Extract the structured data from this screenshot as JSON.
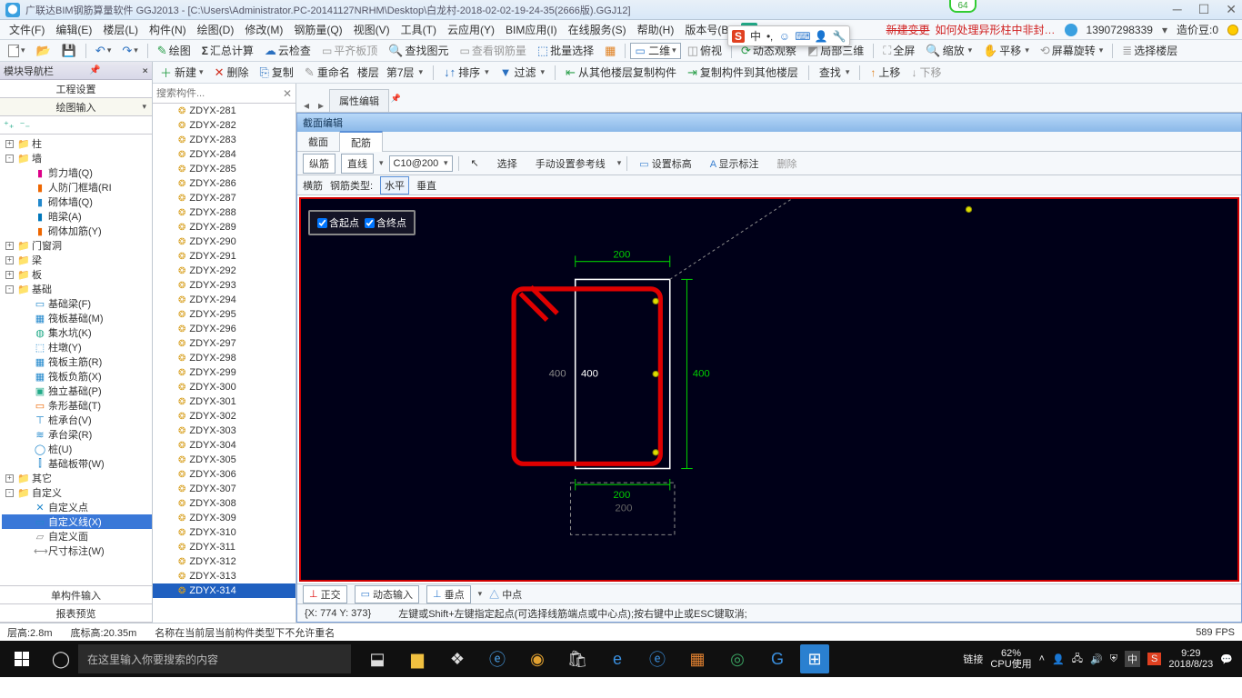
{
  "title": "广联达BIM钢筋算量软件 GGJ2013 - [C:\\Users\\Administrator.PC-20141127NRHM\\Desktop\\白龙村-2018-02-02-19-24-35(2666版).GGJ12]",
  "pill64": "64",
  "menubar": {
    "items": [
      "文件(F)",
      "编辑(E)",
      "楼层(L)",
      "构件(N)",
      "绘图(D)",
      "修改(M)",
      "钢筋量(Q)",
      "视图(V)",
      "工具(T)",
      "云应用(Y)",
      "BIM应用(I)",
      "在线服务(S)",
      "帮助(H)",
      "版本号(B)"
    ],
    "newlink": "新建变更",
    "redlink": "如何处理异形柱中非封…",
    "user": "13907298339",
    "coin_label": "造价豆:0"
  },
  "toolbar1": {
    "items": [
      "绘图",
      "汇总计算",
      "云检查",
      "平齐板顶",
      "查找图元",
      "查看钢筋量",
      "批量选择"
    ],
    "dim_combo": "二维",
    "view_items": [
      "俯视",
      "动态观察",
      "局部三维",
      "全屏",
      "缩放",
      "平移",
      "屏幕旋转",
      "选择楼层"
    ]
  },
  "nav_header": "模块导航栏",
  "nav_sub1": "工程设置",
  "nav_sub2": "绘图输入",
  "tree": [
    {
      "exp": "+",
      "ind": 0,
      "icon": "📁",
      "label": "柱"
    },
    {
      "exp": "-",
      "ind": 0,
      "icon": "📁",
      "label": "墙"
    },
    {
      "ind": 1,
      "icon": "▮",
      "label": "剪力墙(Q)",
      "c": "#d08"
    },
    {
      "ind": 1,
      "icon": "▮",
      "label": "人防门框墙(RI",
      "c": "#e60"
    },
    {
      "ind": 1,
      "icon": "▮",
      "label": "砌体墙(Q)",
      "c": "#28c"
    },
    {
      "ind": 1,
      "icon": "▮",
      "label": "暗梁(A)",
      "c": "#07b"
    },
    {
      "ind": 1,
      "icon": "▮",
      "label": "砌体加筋(Y)",
      "c": "#e60"
    },
    {
      "exp": "+",
      "ind": 0,
      "icon": "📁",
      "label": "门窗洞"
    },
    {
      "exp": "+",
      "ind": 0,
      "icon": "📁",
      "label": "梁"
    },
    {
      "exp": "+",
      "ind": 0,
      "icon": "📁",
      "label": "板"
    },
    {
      "exp": "-",
      "ind": 0,
      "icon": "📁",
      "label": "基础"
    },
    {
      "ind": 1,
      "icon": "▭",
      "label": "基础梁(F)",
      "c": "#28c"
    },
    {
      "ind": 1,
      "icon": "▦",
      "label": "筏板基础(M)",
      "c": "#28c"
    },
    {
      "ind": 1,
      "icon": "◍",
      "label": "集水坑(K)",
      "c": "#2a8"
    },
    {
      "ind": 1,
      "icon": "⬚",
      "label": "柱墩(Y)",
      "c": "#28c"
    },
    {
      "ind": 1,
      "icon": "▦",
      "label": "筏板主筋(R)",
      "c": "#28c"
    },
    {
      "ind": 1,
      "icon": "▦",
      "label": "筏板负筋(X)",
      "c": "#28c"
    },
    {
      "ind": 1,
      "icon": "▣",
      "label": "独立基础(P)",
      "c": "#2a8"
    },
    {
      "ind": 1,
      "icon": "▭",
      "label": "条形基础(T)",
      "c": "#e60"
    },
    {
      "ind": 1,
      "icon": "⊤",
      "label": "桩承台(V)",
      "c": "#28c"
    },
    {
      "ind": 1,
      "icon": "≋",
      "label": "承台梁(R)",
      "c": "#28c"
    },
    {
      "ind": 1,
      "icon": "◯",
      "label": "桩(U)",
      "c": "#28c"
    },
    {
      "ind": 1,
      "icon": "⫿",
      "label": "基础板带(W)",
      "c": "#28c"
    },
    {
      "exp": "+",
      "ind": 0,
      "icon": "📁",
      "label": "其它"
    },
    {
      "exp": "-",
      "ind": 0,
      "icon": "📁",
      "label": "自定义"
    },
    {
      "ind": 1,
      "icon": "✕",
      "label": "自定义点",
      "c": "#28c"
    },
    {
      "ind": 1,
      "icon": "▭",
      "label": "自定义线(X)",
      "c": "#28c",
      "sel": true,
      "extra": "▯"
    },
    {
      "ind": 1,
      "icon": "▱",
      "label": "自定义面",
      "c": "#888"
    },
    {
      "ind": 1,
      "icon": "⟷",
      "label": "尺寸标注(W)",
      "c": "#888"
    }
  ],
  "nav_footers": [
    "单构件输入",
    "报表预览"
  ],
  "toolbar2": {
    "items": [
      "新建",
      "删除",
      "复制",
      "重命名"
    ],
    "floor": "楼层",
    "floor_combo": "第7层",
    "sort": "排序",
    "filter": "过滤",
    "copy_from": "从其他楼层复制构件",
    "copy_to": "复制构件到其他楼层",
    "find": "查找",
    "up": "上移",
    "down": "下移"
  },
  "search_placeholder": "搜索构件...",
  "components_prefix": "ZDYX-",
  "components_from": 281,
  "components_to": 314,
  "selected_component": "ZDYX-314",
  "mini_tab": "属性编辑",
  "se": {
    "title": "截面编辑",
    "tab1": "截面",
    "tab2": "配筋",
    "tb": {
      "zong": "纵筋",
      "line": "直线",
      "spec": "C10@200",
      "select": "选择",
      "manual": "手动设置参考线",
      "elev": "设置标高",
      "anno": "显示标注",
      "del": "删除"
    },
    "tb2": {
      "heng": "横筋",
      "type_label": "钢筋类型:",
      "h": "水平",
      "v": "垂直"
    },
    "chk1": "含起点",
    "chk2": "含终点",
    "dim_top": "200",
    "dim_right": "400",
    "dim_left_outer": "400",
    "dim_left_inner": "400",
    "dim_bot": "200",
    "dim_bot2": "200",
    "opts": {
      "ortho": "正交",
      "dyn": "动态输入",
      "perp": "垂点",
      "mid": "中点"
    },
    "status_xy": "{X: 774 Y: 373}",
    "status_hint": "左键或Shift+左键指定起点(可选择线筋端点或中心点);按右键中止或ESC键取消;"
  },
  "app_status": {
    "h": "层高:2.8m",
    "b": "底标高:20.35m",
    "msg": "名称在当前层当前构件类型下不允许重名",
    "fps": "589 FPS"
  },
  "taskbar": {
    "search": "在这里输入你要搜索的内容",
    "link": "链接",
    "cpu_pct": "62%",
    "cpu_label": "CPU使用",
    "time": "9:29",
    "date": "2018/8/23",
    "lang": "中",
    "sogou": "S"
  },
  "ime": {
    "s": "S",
    "zhong": "中"
  }
}
